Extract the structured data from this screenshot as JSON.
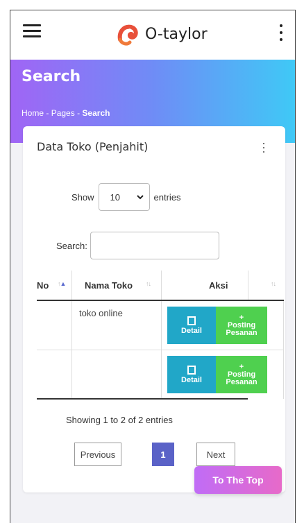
{
  "app": {
    "title": "O-taylor"
  },
  "header": {
    "menu_icon": "hamburger-icon",
    "more_icon": "kebab-icon"
  },
  "hero": {
    "title": "Search",
    "breadcrumb": [
      "Home",
      "Pages",
      "Search"
    ],
    "separator": "-",
    "gradient": [
      "#a065f5",
      "#3fc9f6"
    ]
  },
  "card": {
    "title": "Data Toko (Penjahit)",
    "show_label": "Show",
    "entries_value": "10",
    "entries_label": "entries",
    "search_label": "Search:",
    "search_value": "",
    "columns": [
      "No",
      "Nama Toko",
      "Aksi"
    ],
    "rows": [
      {
        "no": "",
        "nama_toko": "toko online"
      },
      {
        "no": "",
        "nama_toko": ""
      }
    ],
    "detail_label": "Detail",
    "post_plus": "+",
    "post_line1": "Posting",
    "post_line2": "Pesanan",
    "info": "Showing 1 to 2 of 2 entries",
    "pagination": {
      "previous": "Previous",
      "current": "1",
      "next": "Next"
    }
  },
  "to_top": "To The Top",
  "colors": {
    "detail": "#21a7c8",
    "post": "#4fd04f",
    "active_page": "#5a62c7",
    "to_top": "#d06ce0"
  }
}
